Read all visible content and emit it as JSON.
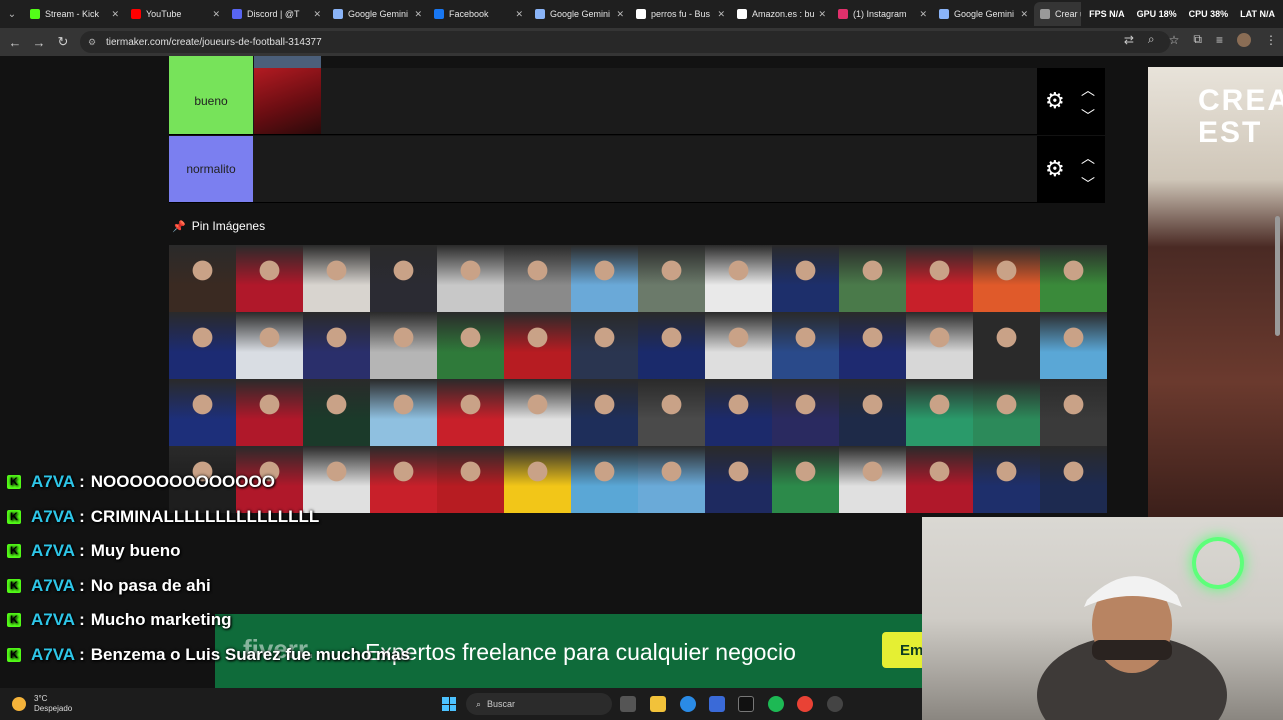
{
  "tabs": [
    {
      "label": "Stream - Kick",
      "icon": "kick-icon",
      "color": "#53fc18"
    },
    {
      "label": "YouTube",
      "icon": "youtube-icon",
      "color": "#ff0000"
    },
    {
      "label": "Discord | @T",
      "icon": "discord-icon",
      "color": "#5865f2"
    },
    {
      "label": "Google Gemini",
      "icon": "gemini-icon",
      "color": "#8ab4f8"
    },
    {
      "label": "Facebook",
      "icon": "facebook-icon",
      "color": "#1877f2"
    },
    {
      "label": "Google Gemini",
      "icon": "gemini-icon",
      "color": "#8ab4f8"
    },
    {
      "label": "perros fu - Bus",
      "icon": "google-icon",
      "color": "#ffffff"
    },
    {
      "label": "Amazon.es : bu",
      "icon": "amazon-icon",
      "color": "#ffffff"
    },
    {
      "label": "(1) Instagram",
      "icon": "instagram-icon",
      "color": "#e1306c"
    },
    {
      "label": "Google Gemini",
      "icon": "gemini-icon",
      "color": "#8ab4f8"
    },
    {
      "label": "Crear una listi",
      "icon": "tiermaker-icon",
      "color": "#999999",
      "active": true
    }
  ],
  "stats": {
    "fps": "FPS N/A",
    "gpu": "GPU 18%",
    "cpu": "CPU 38%",
    "lat": "LAT N/A"
  },
  "address": {
    "url": "tiermaker.com/create/joueurs-de-football-314377"
  },
  "tiers": [
    {
      "label": "bueno",
      "color": "#77e35a"
    },
    {
      "label": "normalito",
      "color": "#7b7ff0"
    }
  ],
  "pin": {
    "title": "Pin Imágenes"
  },
  "ad": {
    "text": "CREA\nEST"
  },
  "chat": [
    {
      "user": "A7VA",
      "message": "NOOOOOOOOOOOOO"
    },
    {
      "user": "A7VA",
      "message": "CRIMINALLLLLLLLLLLLLLL"
    },
    {
      "user": "A7VA",
      "message": "Muy bueno"
    },
    {
      "user": "A7VA",
      "message": "No pasa de ahi"
    },
    {
      "user": "A7VA",
      "message": "Mucho marketing"
    },
    {
      "user": "A7VA",
      "message": "Benzema o Luis Suarez fue mucho mas"
    }
  ],
  "banner": {
    "logo": "fiverr.",
    "text": "Expertos freelance para cualquier negocio",
    "cta": "Em"
  },
  "taskbar": {
    "temp": "3°C",
    "condition": "Despejado",
    "search": "Buscar"
  },
  "grid_colors": [
    "#3a2a22",
    "#b0182a",
    "#d8d4cf",
    "#2b2b33",
    "#c8c8c8",
    "#8a8a8a",
    "#6aa9d8",
    "#6b7a6a",
    "#e9e9e9",
    "#1d2f6b",
    "#4a7a4a",
    "#c8202a",
    "#e05a2a",
    "#3a8a3a",
    "#1c2b73",
    "#d9dde3",
    "#2a2f6b",
    "#b5b5b5",
    "#2f7a3a",
    "#b71c22",
    "#2a3550",
    "#1a2a6b",
    "#dedede",
    "#2a4a8a",
    "#1e2a70",
    "#d7d7d7",
    "#2a2a2a",
    "#5aa7d6",
    "#1d2f7a",
    "#b0182a",
    "#1b3a2a",
    "#8fc0e0",
    "#c8202a",
    "#e0e0e0",
    "#1e2e5a",
    "#4a4a4a",
    "#1c2a6b",
    "#2a2a60",
    "#1e2a48",
    "#2a9a6a",
    "#2c8a5a",
    "#3a3a3a",
    "#1e1e1e",
    "#b0182a",
    "#e0e0e0",
    "#c8202a",
    "#b71c22",
    "#f2c618",
    "#5aa7d6",
    "#6aaad8",
    "#1e2a60",
    "#2c8a4a",
    "#e0e0e0",
    "#b0182a",
    "#1e2f6b",
    "#1d2a50"
  ]
}
